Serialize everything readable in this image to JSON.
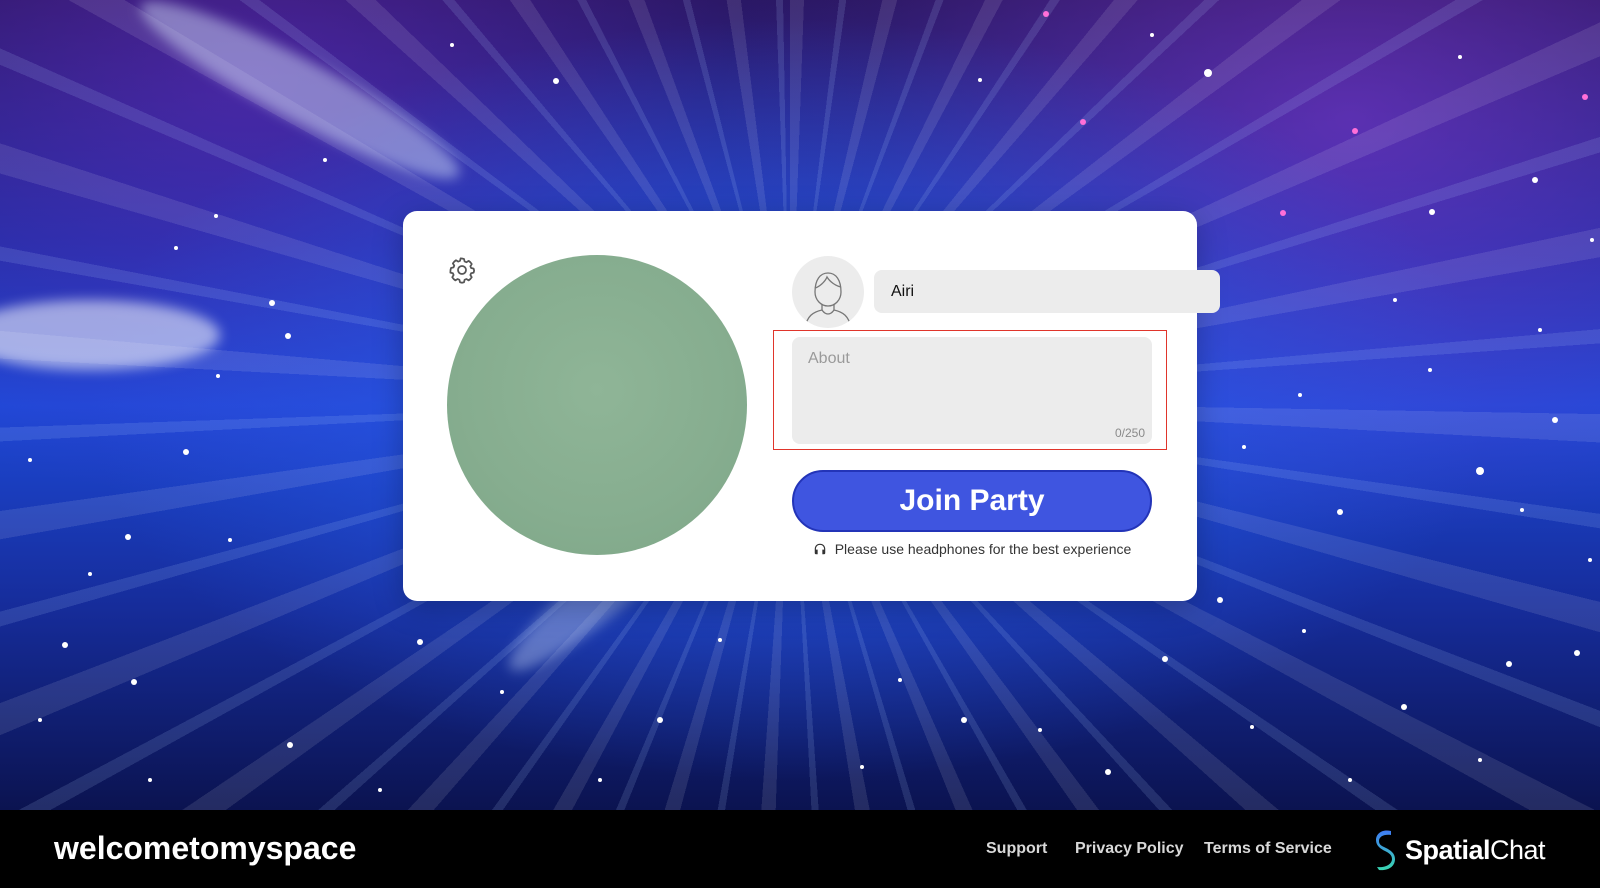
{
  "profile": {
    "name_value": "Airi",
    "about_placeholder": "About",
    "about_value": "",
    "char_count": "0/250",
    "join_button_label": "Join Party",
    "headphones_note": "Please use headphones for the best experience"
  },
  "footer": {
    "space_name": "welcometomyspace",
    "links": [
      "Support",
      "Privacy Policy",
      "Terms of Service"
    ],
    "brand_bold": "Spatial",
    "brand_light": "Chat"
  },
  "icons": {
    "settings": "gear-icon",
    "avatar": "user-avatar-icon",
    "headphones": "headphones-icon",
    "brand_logo": "spatialchat-logo"
  },
  "colors": {
    "join_button": "#3f55e0",
    "highlight_border": "#e0352b",
    "footer_bg": "#000000",
    "card_bg": "#ffffff",
    "input_bg": "#ececec",
    "video_preview": "#88ae90"
  }
}
